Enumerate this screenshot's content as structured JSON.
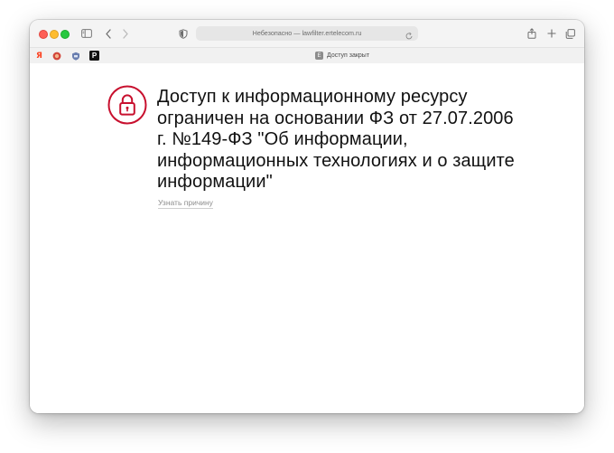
{
  "browser": {
    "address_text": "Небезопасно — lawfilter.ertelecom.ru",
    "tab_title": "Доступ закрыт",
    "tab_favicon_letter": "E",
    "favorites": [
      {
        "name": "yandex",
        "glyph": "Я",
        "color": "#fc3f1d"
      },
      {
        "name": "site-2",
        "glyph": "",
        "color": "#d2453a"
      },
      {
        "name": "site-3",
        "glyph": "",
        "color": "#6a7fb0"
      },
      {
        "name": "site-4",
        "glyph": "P",
        "color": "#111111"
      }
    ],
    "icons": [
      "sidebar-icon",
      "back-icon",
      "forward-icon",
      "privacy-shield-icon",
      "reload-icon",
      "share-icon",
      "new-tab-icon",
      "tabs-overview-icon"
    ]
  },
  "page": {
    "headline": "Доступ к информационному ресурсу ограничен на основании ФЗ от 27.07.2006 г. №149-ФЗ \"Об информации, информационных технологиях и о защите информации\"",
    "reason_link": "Узнать причину",
    "accent_color": "#c8102e",
    "icon": "lock-icon"
  }
}
